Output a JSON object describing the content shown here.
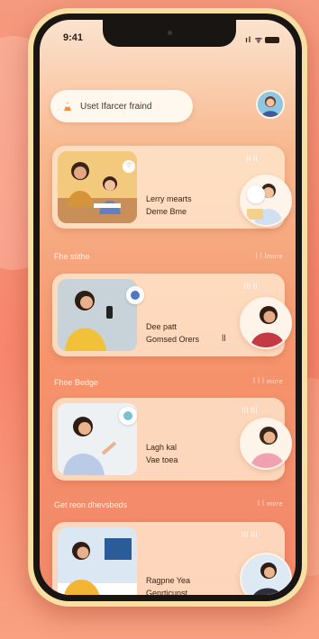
{
  "status_bar": {
    "time": "9:41",
    "icons": "ıl ᯤ"
  },
  "search": {
    "text": "Uset Ifarcer fraind"
  },
  "sections": [
    {
      "label": "Fhe stithe",
      "link": "ꟾ ꟾ ꟾmore"
    },
    {
      "label": "Fhee Bedge",
      "link": "ꟾ ꟾ ꟾ more"
    },
    {
      "label": "Get reon dhevsbeds",
      "link": "ꟾ ꟾ more"
    }
  ],
  "cards": [
    {
      "title_line1": "Lerry mearts",
      "title_line2": "Deme Bme",
      "meta": "ꟾꟾ  ꟾꟾ",
      "badge": "♡"
    },
    {
      "title_line1": "Dee patt",
      "title_line2": "Gomsed Orers",
      "meta": "ꟾꟾꟾ ꟾꟾ",
      "extra": "ꟾꟾ"
    },
    {
      "title_line1": "Lagh kal",
      "title_line2": "Vae toea",
      "meta": "ꟾꟾꟾ ꟾꟾꟾ"
    },
    {
      "title_line1": "Ragpne Yea",
      "title_line2": "Genrticunst.",
      "meta": "ꟾꟾꟾ ꟾꟾꟾ"
    }
  ],
  "colors": {
    "accent": "#f5936c",
    "card": "#ffe6cd",
    "frame": "#f8dfa2"
  }
}
